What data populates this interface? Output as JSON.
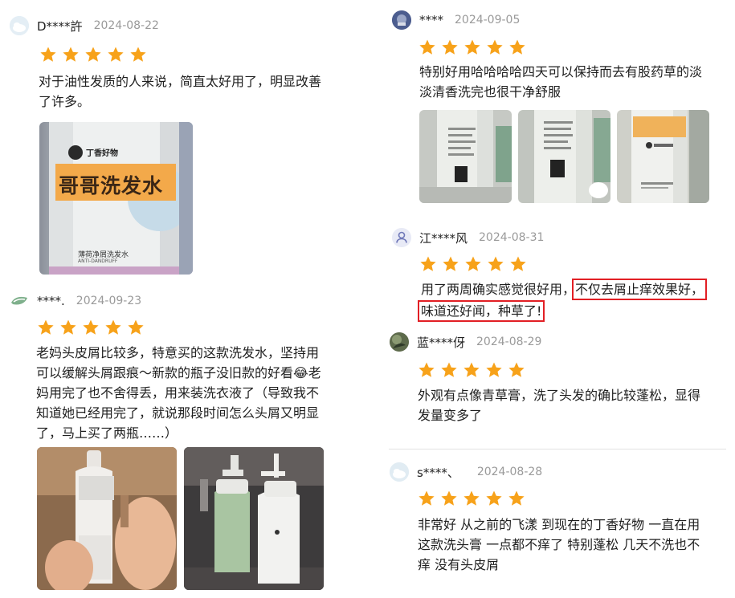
{
  "reviews": [
    {
      "user": "D****許",
      "date": "2024-08-22",
      "lines": [
        "对于油性发质的人来说，简直太好用了，明显改善",
        "了许多。"
      ],
      "photo": {
        "brand": "丁香好物",
        "product": "哥哥洗发水",
        "subtitle": "薄荷净屑洗发水",
        "tag": "ANTI-DANDRUFF"
      }
    },
    {
      "user": "****.",
      "date": "2024-09-23",
      "lines": [
        "老妈头皮屑比较多，特意买的这款洗发水，坚持用",
        "可以缓解头屑跟痕～新款的瓶子没旧款的好看😂老",
        "妈用完了也不舍得丢，用来装洗衣液了（导致我不",
        "知道她已经用完了，就说那段时间怎么头屑又明显",
        "了，马上买了两瓶……）"
      ]
    },
    {
      "user": "****",
      "date": "2024-09-05",
      "lines": [
        "特别好用哈哈哈哈四天可以保持而去有股药草的淡",
        "淡清香洗完也很干净舒服"
      ]
    },
    {
      "user": "江****风",
      "date": "2024-08-31",
      "line1_plain": "用了两周确实感觉很好用，",
      "line1_highlight": "不仅去屑止痒效果好，",
      "line2_highlight": "味道还好闻，种草了!"
    },
    {
      "user": "蓝****伢",
      "date": "2024-08-29",
      "lines": [
        "外观有点像青草膏，洗了头发的确比较蓬松，显得",
        "发量变多了"
      ]
    },
    {
      "user": "s****、",
      "date": "2024-08-28",
      "lines": [
        "非常好 从之前的飞漾 到现在的丁香好物 一直在用",
        "这款洗头膏 一点都不痒了 特别蓬松 几天不洗也不",
        "痒 没有头皮屑"
      ]
    }
  ],
  "rating_stars": 5,
  "colors": {
    "star": "#f7a21a",
    "highlight_box": "#e21f25",
    "date": "#9a9a9a"
  },
  "icons": {
    "default_avatar": "person-icon",
    "star": "star-icon"
  }
}
